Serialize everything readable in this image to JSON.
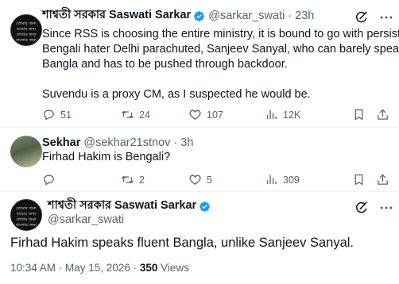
{
  "tweet1": {
    "display_name": "শাশ্বতী সরকার Saswati Sarkar",
    "handle": "@sarkar_swati",
    "time": "23h",
    "avatar_text": [
      "তোমার জন্য",
      "আমার জন্য",
      "লেখার জন্য",
      "বাংলার জন্য"
    ],
    "text_lines": [
      "Since RSS is choosing the entire ministry, it is bound to go with persistent",
      "Bengali hater Delhi parachuted, Sanjeev Sanyal, who can barely speak",
      "Bangla and has to be pushed through backdoor.",
      "",
      "Suvendu is a proxy CM, as I suspected he would be."
    ],
    "replies": "51",
    "reposts": "24",
    "likes": "107",
    "views": "12K"
  },
  "tweet2": {
    "display_name": "Sekhar",
    "handle": "@sekhar21stnov",
    "time": "3h",
    "text": "Firhad Hakim is Bengali?",
    "replies": "",
    "reposts": "2",
    "likes": "5",
    "views": "309"
  },
  "tweet3": {
    "display_name": "শাশ্বতী সরকার Saswati Sarkar",
    "handle": "@sarkar_swati",
    "text": "Firhad Hakim speaks fluent Bangla, unlike Sanjeev Sanyal.",
    "timestamp": "10:34 AM · May 15, 2026",
    "views_count": "350",
    "views_label": "Views"
  },
  "separator": "·",
  "colors": {
    "verified": "#1d9bf0",
    "secondary_text": "#536471",
    "primary_text": "#0f1419",
    "thread_line": "#cfd9de"
  },
  "icons": [
    "verified-badge-icon",
    "grok-icon",
    "more-icon",
    "reply-icon",
    "repost-icon",
    "like-icon",
    "views-icon",
    "bookmark-icon",
    "share-icon"
  ]
}
